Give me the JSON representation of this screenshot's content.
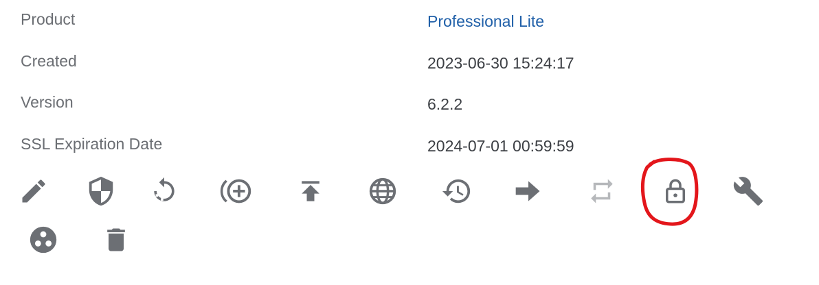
{
  "details": {
    "rows": [
      {
        "label": "Product",
        "value": "Professional Lite"
      },
      {
        "label": "Created",
        "value": "2023-06-30 15:24:17"
      },
      {
        "label": "Version",
        "value": "6.2.2"
      },
      {
        "label": "SSL Expiration Date",
        "value": "2024-07-01 00:59:59"
      }
    ]
  },
  "actions": [
    {
      "icon": "pencil-icon",
      "enabled": true
    },
    {
      "icon": "shield-icon",
      "enabled": true
    },
    {
      "icon": "restart-icon",
      "enabled": true
    },
    {
      "icon": "add-circle-icon",
      "enabled": true
    },
    {
      "icon": "upload-icon",
      "enabled": true
    },
    {
      "icon": "globe-icon",
      "enabled": true
    },
    {
      "icon": "history-icon",
      "enabled": true
    },
    {
      "icon": "arrow-right-icon",
      "enabled": true
    },
    {
      "icon": "repeat-icon",
      "enabled": false
    },
    {
      "icon": "lock-icon",
      "enabled": true,
      "annotated": true
    },
    {
      "icon": "wrench-icon",
      "enabled": true
    },
    {
      "icon": "group-icon",
      "enabled": true
    },
    {
      "icon": "trash-icon",
      "enabled": true
    }
  ],
  "colors": {
    "label": "#6b6e73",
    "value": "#3c3f44",
    "link": "#1f5fa8",
    "icon": "#6c6f74",
    "icon_disabled": "#b6b8bb",
    "annotation": "#e3161b"
  }
}
